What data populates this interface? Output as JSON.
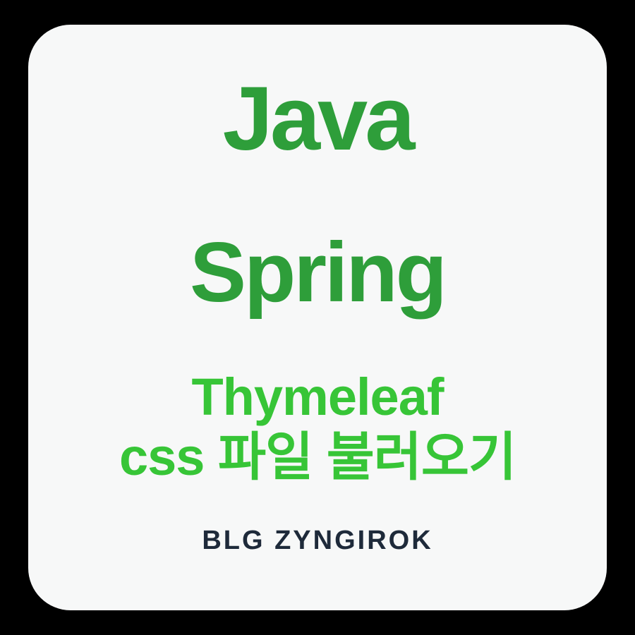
{
  "card": {
    "title1": "Java",
    "title2": "Spring",
    "subtitle_line1": "Thymeleaf",
    "subtitle_line2": "css 파일 불러오기",
    "footer": "BLG ZYNGIROK"
  },
  "colors": {
    "background": "#000000",
    "card_background": "#f7f8f8",
    "title_green_dark": "#2e9e3a",
    "subtitle_green_bright": "#37c537",
    "footer_dark": "#1e2a3a"
  }
}
